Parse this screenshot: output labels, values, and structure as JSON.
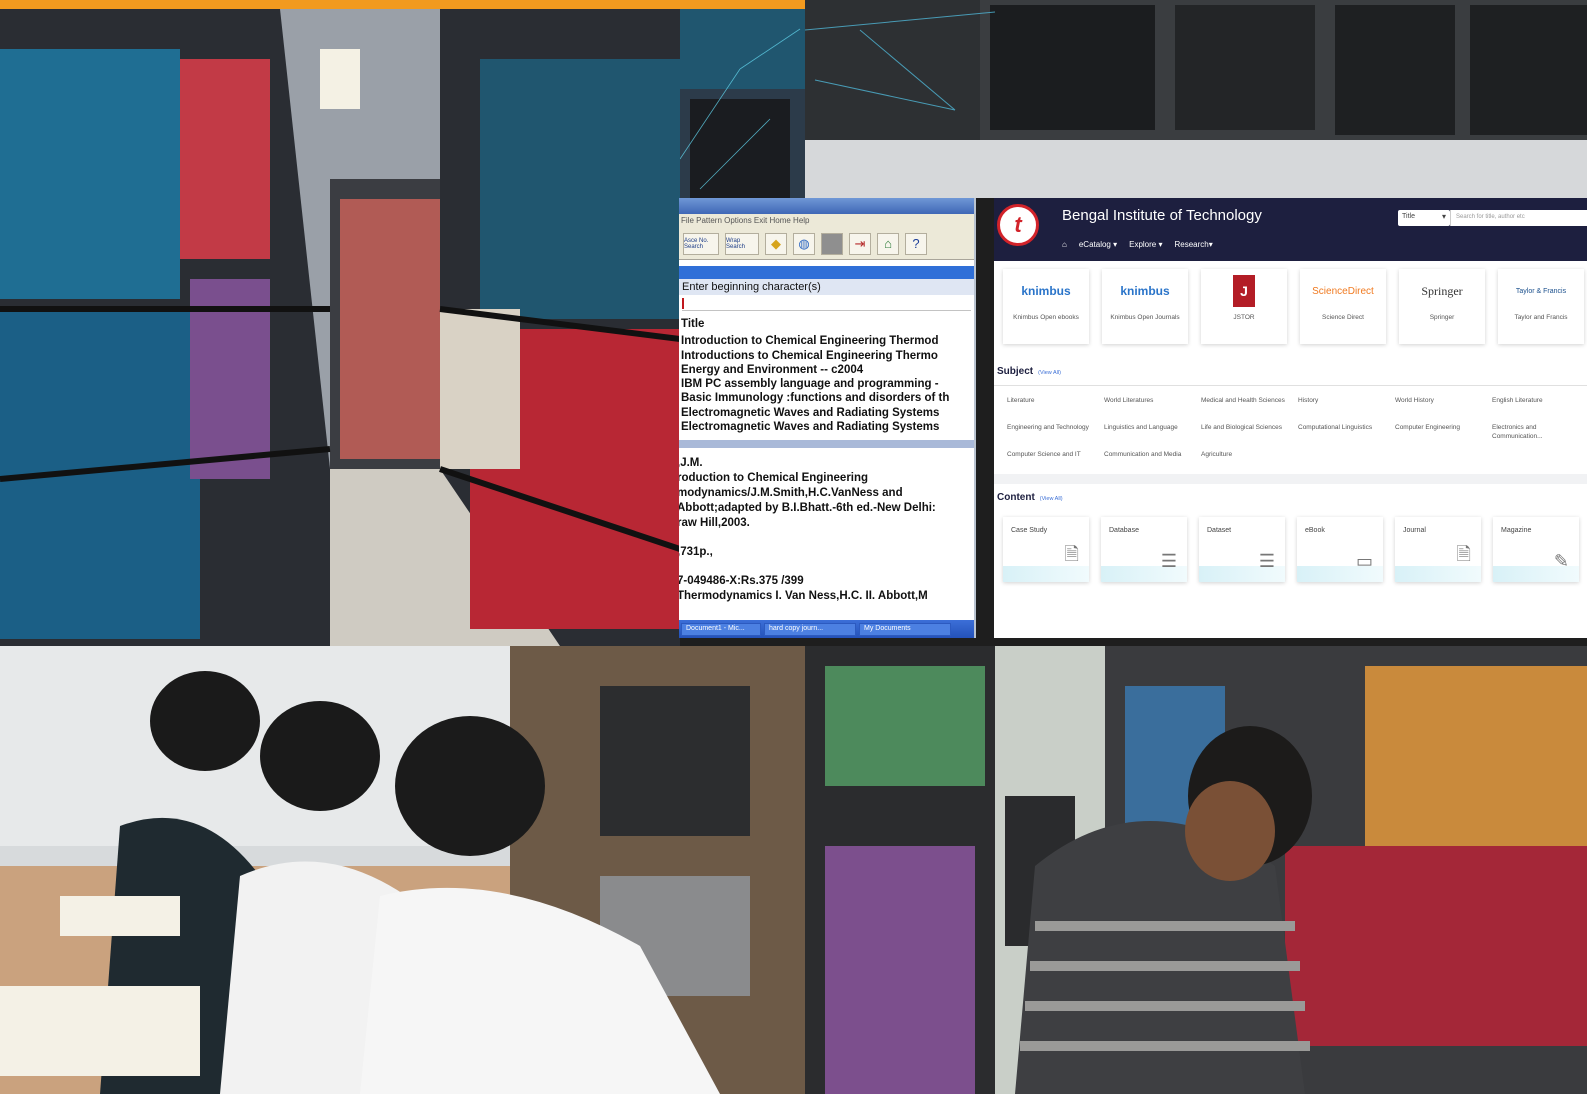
{
  "colors": {
    "accent_bar": "#f29a1f",
    "portal_header": "#1d1f3f",
    "catalog_blue": "#2f6fd8",
    "logo_red": "#d2232a"
  },
  "catalog": {
    "menu": "File  Pattern  Options  Exit  Home  Help",
    "toolbar_buttons": [
      "Asce No. Search",
      "Wrap Search"
    ],
    "toolbar_icons": [
      "diamond-icon",
      "globe-icon",
      "blank-icon",
      "exit-icon",
      "home-icon",
      "help-icon"
    ],
    "prompt": "Enter beginning character(s)",
    "list_header": "Title",
    "titles": [
      "Introduction to Chemical Engineering Thermod",
      "Introductions to Chemical Engineering Thermo",
      "Energy and Environment -- c2004",
      "IBM PC assembly language and programming -",
      "Basic Immunology :functions and disorders of th",
      "Electromagnetic Waves and Radiating Systems",
      "Electromagnetic Waves and Radiating Systems"
    ],
    "detail": [
      ",J.M.",
      "roduction to Chemical Engineering",
      "modynamics/J.M.Smith,H.C.VanNess and",
      "Abbott;adapted by B.I.Bhatt.-6th ed.-New Delhi:",
      "raw Hill,2003.",
      "",
      ",731p.,",
      "",
      "7-049486-X:Rs.375 /399",
      "Thermodynamics  I. Van Ness,H.C.  II. Abbott,M"
    ],
    "taskbar": [
      "Document1 - Mic...",
      "hard copy journ...",
      "My Documents"
    ]
  },
  "portal": {
    "title": "Bengal Institute of Technology",
    "nav": [
      "eCatalog ▾",
      "Explore ▾",
      "Research▾"
    ],
    "search_select": "Title",
    "search_placeholder": "Search for title, author etc",
    "providers": [
      {
        "logo": "knimbus",
        "name": "Knimbus Open ebooks"
      },
      {
        "logo": "knimbus",
        "name": "Knimbus Open Journals"
      },
      {
        "logo": "J",
        "name": "JSTOR"
      },
      {
        "logo": "ScienceDirect",
        "name": "Science Direct"
      },
      {
        "logo": "Springer",
        "name": "Springer"
      },
      {
        "logo": "Taylor & Francis",
        "name": "Taylor and Francis"
      }
    ],
    "subject_heading": "Subject",
    "content_heading": "Content",
    "view_all": "(View All)",
    "subjects": [
      "Literature",
      "World Literatures",
      "Medical and Health Sciences",
      "History",
      "World History",
      "English Literature",
      "Engineering and Technology",
      "Linguistics and Language",
      "Life and Biological Sciences",
      "Computational Linguistics",
      "Computer Engineering",
      "Electronics and Communication...",
      "Computer Science and IT",
      "Communication and Media",
      "Agriculture",
      "",
      "",
      ""
    ],
    "content_types": [
      {
        "label": "Case Study",
        "icon": "document-search-icon"
      },
      {
        "label": "Database",
        "icon": "database-icon"
      },
      {
        "label": "Dataset",
        "icon": "dataset-icon"
      },
      {
        "label": "eBook",
        "icon": "book-icon"
      },
      {
        "label": "Journal",
        "icon": "journal-icon"
      },
      {
        "label": "Magazine",
        "icon": "magazine-icon"
      }
    ]
  }
}
